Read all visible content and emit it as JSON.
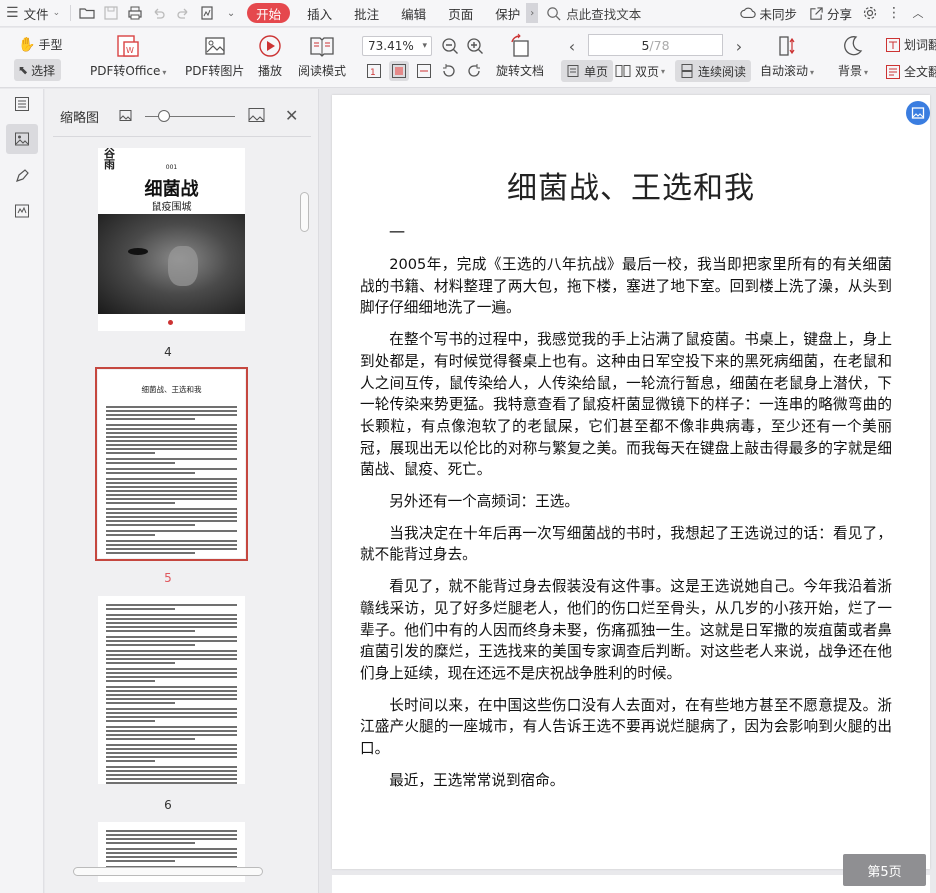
{
  "menu": {
    "file": "文件",
    "tabs": [
      "开始",
      "插入",
      "批注",
      "编辑",
      "页面",
      "保护"
    ],
    "search": "点此查找文本",
    "sync": "未同步",
    "share": "分享"
  },
  "toolbar": {
    "hand": "手型",
    "select": "选择",
    "pdf_to_office": "PDF转Office",
    "pdf_to_image": "PDF转图片",
    "play": "播放",
    "read_mode": "阅读模式",
    "zoom": "73.41%",
    "rotate_doc": "旋转文档",
    "page_current": "5",
    "page_total": "/78",
    "single_page": "单页",
    "double_page": "双页",
    "continuous": "连续阅读",
    "auto_scroll": "自动滚动",
    "background": "背景",
    "word_lookup": "划词翻",
    "full_text": "全文翻"
  },
  "thumbnails": {
    "title": "缩略图",
    "cover": {
      "tag": "001",
      "title": "细菌战",
      "subtitle": "鼠疫围城"
    },
    "page5_title": "细菌战、王选和我",
    "pages": [
      "4",
      "5",
      "6"
    ]
  },
  "document": {
    "title": "细菌战、王选和我",
    "section": "一",
    "paragraphs": [
      "2005年，完成《王选的八年抗战》最后一校，我当即把家里所有的有关细菌战的书籍、材料整理了两大包，拖下楼，塞进了地下室。回到楼上洗了澡，从头到脚仔仔细细地洗了一遍。",
      "在整个写书的过程中，我感觉我的手上沾满了鼠疫菌。书桌上，键盘上，身上到处都是，有时候觉得餐桌上也有。这种由日军空投下来的黑死病细菌，在老鼠和人之间互传，鼠传染给人，人传染给鼠，一轮流行暂息，细菌在老鼠身上潜伏，下一轮传染来势更猛。我特意查看了鼠疫杆菌显微镜下的样子：一连串的略微弯曲的长颗粒，有点像泡软了的老鼠屎，它们甚至都不像非典病毒，至少还有一个美丽冠，展现出无以伦比的对称与繁复之美。而我每天在键盘上敲击得最多的字就是细菌战、鼠疫、死亡。",
      "另外还有一个高频词：王选。",
      "当我决定在十年后再一次写细菌战的书时，我想起了王选说过的话：看见了，就不能背过身去。",
      "看见了，就不能背过身去假装没有这件事。这是王选说她自己。今年我沿着浙赣线采访，见了好多烂腿老人，他们的伤口烂至骨头，从几岁的小孩开始，烂了一辈子。他们中有的人因而终身未娶，伤痛孤独一生。这就是日军撒的炭疽菌或者鼻疽菌引发的糜烂，王选找来的美国专家调查后判断。对这些老人来说，战争还在他们身上延续，现在还远不是庆祝战争胜利的时候。",
      "长时间以来，在中国这些伤口没有人去面对，在有些地方甚至不愿意提及。浙江盛产火腿的一座城市，有人告诉王选不要再说烂腿病了，因为会影响到火腿的出口。",
      "最近，王选常常说到宿命。"
    ],
    "page_pill": "第5页"
  },
  "colors": {
    "accent_red": "#e5484d",
    "thumb_selected": "#c5473f",
    "float_blue": "#3a7de0"
  }
}
